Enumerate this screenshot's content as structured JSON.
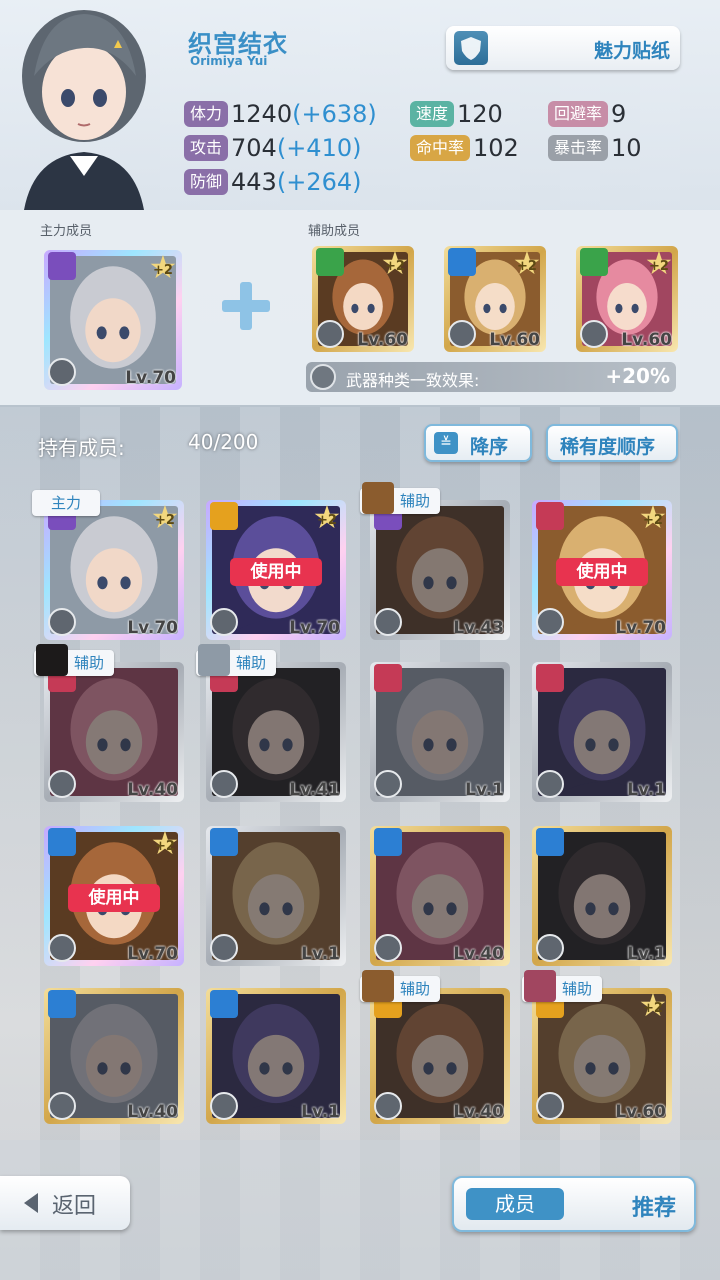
{
  "character": {
    "name": "织宫结衣",
    "name_en": "Orimiya Yui",
    "charm_button": "魅力贴纸"
  },
  "stats": {
    "hp": {
      "label": "体力",
      "value": "1240",
      "bonus": "(+638)"
    },
    "atk": {
      "label": "攻击",
      "value": "704",
      "bonus": "(+410)"
    },
    "def": {
      "label": "防御",
      "value": "443",
      "bonus": "(+264)"
    },
    "spd": {
      "label": "速度",
      "value": "120"
    },
    "hit": {
      "label": "命中率",
      "value": "102"
    },
    "eva": {
      "label": "回避率",
      "value": "9"
    },
    "crit": {
      "label": "暴击率",
      "value": "10"
    }
  },
  "team": {
    "main_label": "主力成员",
    "support_label": "辅助成员",
    "main_card": {
      "level": "Lv.70",
      "plus": "+2",
      "element": "purple"
    },
    "support_cards": [
      {
        "level": "Lv.60",
        "plus": "+2",
        "element": "green"
      },
      {
        "level": "Lv.60",
        "plus": "+2",
        "element": "blue"
      },
      {
        "level": "Lv.60",
        "plus": "+2",
        "element": "green"
      }
    ],
    "weapon_effect_label": "武器种类一致效果:",
    "weapon_effect_value": "+20%"
  },
  "list": {
    "owned_label": "持有成员:",
    "owned_count": "40/200",
    "sort_desc_label": "降序",
    "sort_rarity_label": "稀有度顺序",
    "cards": [
      {
        "level": "Lv.70",
        "plus": "+2",
        "element": "purple",
        "frame": "rainbow",
        "tag": "主力",
        "in_use": "",
        "dim": false
      },
      {
        "level": "Lv.70",
        "plus": "+2",
        "element": "gold",
        "frame": "rainbow",
        "tag": "",
        "in_use": "使用中",
        "dim": false
      },
      {
        "level": "Lv.43",
        "plus": "",
        "element": "purple",
        "frame": "silver",
        "tag": "辅助",
        "in_use": "",
        "dim": true
      },
      {
        "level": "Lv.70",
        "plus": "+2",
        "element": "red",
        "frame": "rainbow",
        "tag": "",
        "in_use": "使用中",
        "dim": false
      },
      {
        "level": "Lv.40",
        "plus": "",
        "element": "red",
        "frame": "silver",
        "tag": "辅助",
        "in_use": "",
        "dim": true
      },
      {
        "level": "Lv.41",
        "plus": "",
        "element": "red",
        "frame": "silver",
        "tag": "辅助",
        "in_use": "",
        "dim": true
      },
      {
        "level": "Lv.1",
        "plus": "",
        "element": "red",
        "frame": "silver",
        "tag": "",
        "in_use": "",
        "dim": true
      },
      {
        "level": "Lv.1",
        "plus": "",
        "element": "red",
        "frame": "silver",
        "tag": "",
        "in_use": "",
        "dim": true
      },
      {
        "level": "Lv.70",
        "plus": "+2",
        "element": "blue",
        "frame": "rainbow",
        "tag": "",
        "in_use": "使用中",
        "dim": false
      },
      {
        "level": "Lv.1",
        "plus": "",
        "element": "blue",
        "frame": "silver",
        "tag": "",
        "in_use": "",
        "dim": true
      },
      {
        "level": "Lv.40",
        "plus": "",
        "element": "blue",
        "frame": "gold",
        "tag": "",
        "in_use": "",
        "dim": true
      },
      {
        "level": "Lv.1",
        "plus": "",
        "element": "blue",
        "frame": "gold",
        "tag": "",
        "in_use": "",
        "dim": true
      },
      {
        "level": "Lv.40",
        "plus": "",
        "element": "blue",
        "frame": "gold",
        "tag": "",
        "in_use": "",
        "dim": true
      },
      {
        "level": "Lv.1",
        "plus": "",
        "element": "blue",
        "frame": "gold",
        "tag": "",
        "in_use": "",
        "dim": true
      },
      {
        "level": "Lv.40",
        "plus": "",
        "element": "gold",
        "frame": "gold",
        "tag": "辅助",
        "in_use": "",
        "dim": true
      },
      {
        "level": "Lv.60",
        "plus": "+2",
        "element": "gold",
        "frame": "gold",
        "tag": "辅助",
        "in_use": "",
        "dim": true
      }
    ]
  },
  "footer": {
    "back_label": "返回",
    "members_label": "成员",
    "recommend_label": "推荐"
  },
  "colors": {
    "accent": "#2f84bd",
    "in_use": "#e8334f",
    "bonus": "#2f8fd0"
  }
}
